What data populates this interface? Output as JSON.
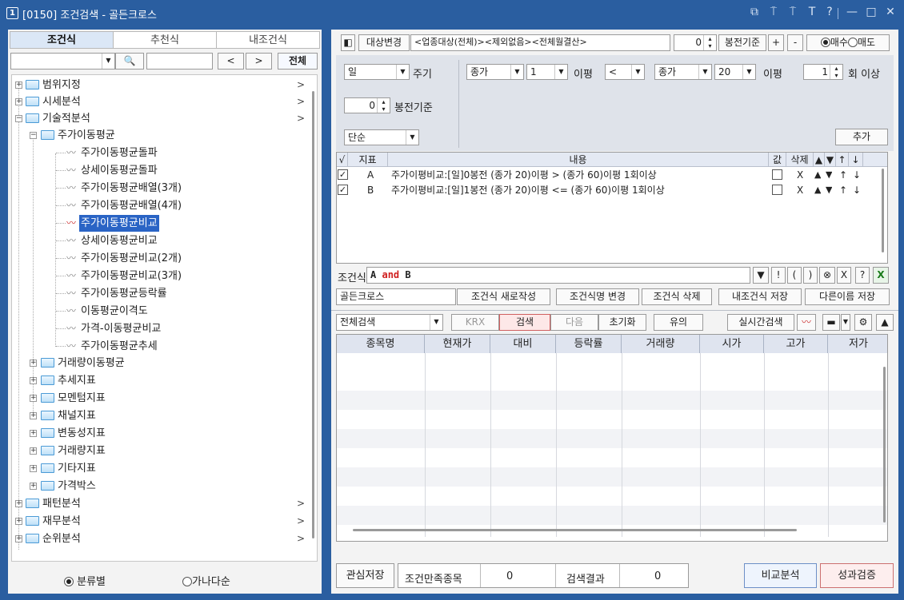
{
  "title": {
    "num": "1",
    "text": "[0150] 조건검색 - 골든크로스",
    "controls": [
      "⧉",
      "⍑",
      "⍑",
      "T",
      "?",
      "—",
      "□",
      "✕"
    ]
  },
  "left": {
    "tabs": [
      "조건식",
      "추천식",
      "내조건식"
    ],
    "search": {
      "all_label": "전체",
      "prev": "<",
      "next": ">"
    },
    "tree": [
      {
        "label": "범위지정",
        "arrow": ">"
      },
      {
        "label": "시세분석",
        "arrow": ">"
      },
      {
        "label": "기술적분석",
        "arrow": ">"
      },
      {
        "label": "주가이동평균"
      },
      {
        "label": "주가이동평균돌파"
      },
      {
        "label": "상세이동평균돌파"
      },
      {
        "label": "주가이동평균배열(3개)"
      },
      {
        "label": "주가이동평균배열(4개)"
      },
      {
        "label": "주가이동평균비교"
      },
      {
        "label": "상세이동평균비교"
      },
      {
        "label": "주가이동평균비교(2개)"
      },
      {
        "label": "주가이동평균비교(3개)"
      },
      {
        "label": "주가이동평균등락률"
      },
      {
        "label": "이동평균이격도"
      },
      {
        "label": "가격-이동평균비교"
      },
      {
        "label": "주가이동평균추세"
      },
      {
        "label": "거래량이동평균"
      },
      {
        "label": "추세지표"
      },
      {
        "label": "모멘텀지표"
      },
      {
        "label": "채널지표"
      },
      {
        "label": "변동성지표"
      },
      {
        "label": "거래량지표"
      },
      {
        "label": "기타지표"
      },
      {
        "label": "가격박스"
      },
      {
        "label": "패턴분석",
        "arrow": ">"
      },
      {
        "label": "재무분석",
        "arrow": ">"
      },
      {
        "label": "순위분석",
        "arrow": ">"
      }
    ],
    "radio": {
      "opt1": "분류별",
      "opt2": "가나다순"
    }
  },
  "right": {
    "target": {
      "btn": "대상변경",
      "value": "<업종대상(전체)><제외없음><전체월결산>",
      "bong": "0",
      "bong_label": "봉전기준",
      "plus": "+",
      "minus": "-",
      "buy": "매수",
      "sell": "매도"
    },
    "params": {
      "period": "일",
      "period_label": "주기",
      "price1": "종가",
      "n1": "1",
      "ma_label1": "이평",
      "op": "<",
      "price2": "종가",
      "n2": "20",
      "ma_label2": "이평",
      "times": "1",
      "times_label": "회 이상",
      "bong": "0",
      "bong_label": "봉전기준",
      "mode": "단순",
      "add": "추가"
    },
    "cond_headers": [
      "√",
      "지표",
      "내용",
      "값",
      "삭제",
      "▲",
      "▼",
      "↑",
      "↓"
    ],
    "conditions": [
      {
        "key": "A",
        "text": "주가이평비교:[일]0봉전 (종가 20)이평 > (종가 60)이평 1회이상",
        "del": "X"
      },
      {
        "key": "B",
        "text": "주가이평비교:[일]1봉전 (종가 20)이평 <= (종가 60)이평 1회이상",
        "del": "X"
      }
    ],
    "formula": {
      "label": "조건식",
      "a": "A",
      "and": "and",
      "b": "B",
      "buttons": [
        "▼",
        "!",
        "(",
        ")",
        "⊗",
        "X",
        "?"
      ]
    },
    "name": {
      "value": "골든크로스",
      "new": "조건식 새로작성",
      "rename": "조건식명 변경",
      "delete": "조건식 삭제",
      "save": "내조건식 저장",
      "saveas": "다른이름 저장"
    },
    "search": {
      "scope": "전체검색",
      "krx": "KRX",
      "search": "검색",
      "next": "다음",
      "reset": "초기화",
      "note": "유의",
      "realtime": "실시간검색"
    },
    "result_headers": [
      "종목명",
      "현재가",
      "대비",
      "등락률",
      "거래량",
      "시가",
      "고가",
      "저가"
    ],
    "bottom": {
      "fav": "관심저장",
      "match_label": "조건만족종목",
      "match": "0",
      "result_label": "검색결과",
      "result": "0",
      "compare": "비교분석",
      "verify": "성과검증"
    }
  }
}
